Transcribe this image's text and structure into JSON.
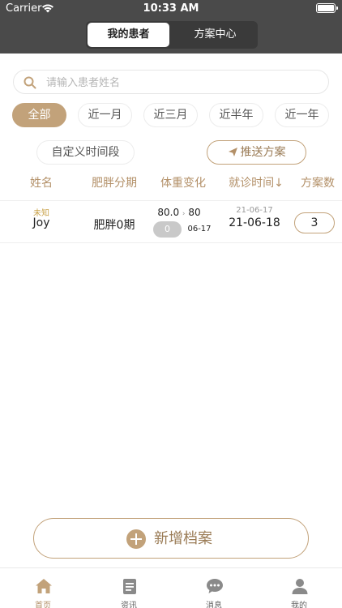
{
  "status": {
    "carrier": "Carrier",
    "time": "10:33 AM"
  },
  "segment": {
    "active": "我的患者",
    "inactive": "方案中心"
  },
  "search": {
    "placeholder": "请输入患者姓名"
  },
  "filters": [
    "全部",
    "近一月",
    "近三月",
    "近半年",
    "近一年"
  ],
  "custom_range": "自定义时间段",
  "push_plan": "推送方案",
  "table": {
    "headers": [
      "姓名",
      "肥胖分期",
      "体重变化",
      "就诊时间↓",
      "方案数"
    ],
    "rows": [
      {
        "tag": "未知",
        "name": "Joy",
        "stage": "肥胖0期",
        "weight_from": "80.0",
        "weight_sep": "›",
        "weight_to": "80",
        "weight_change": "0",
        "weight_date": "06-17",
        "visit_small": "21-06-17",
        "visit": "21-06-18",
        "plans": "3"
      }
    ]
  },
  "add_button": "新增档案",
  "tabs": [
    "首页",
    "资讯",
    "消息",
    "我的"
  ],
  "colors": {
    "accent": "#c2a27a",
    "header_bg": "#4a4a4a",
    "header_text": "#b39068"
  }
}
